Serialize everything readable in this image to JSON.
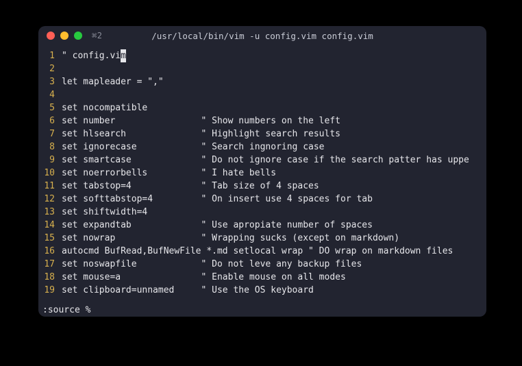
{
  "titlebar": {
    "shortcut": "⌘2",
    "title": "/usr/local/bin/vim -u config.vim config.vim"
  },
  "cursor_line_index": 0,
  "cursor_prefix": "\" config.vi",
  "cursor_char": "m",
  "lines": [
    {
      "n": 1,
      "text": "\" config.vim"
    },
    {
      "n": 2,
      "text": ""
    },
    {
      "n": 3,
      "text": "let mapleader = \",\""
    },
    {
      "n": 4,
      "text": ""
    },
    {
      "n": 5,
      "text": "set nocompatible"
    },
    {
      "n": 6,
      "text": "set number                \" Show numbers on the left"
    },
    {
      "n": 7,
      "text": "set hlsearch              \" Highlight search results"
    },
    {
      "n": 8,
      "text": "set ignorecase            \" Search ingnoring case"
    },
    {
      "n": 9,
      "text": "set smartcase             \" Do not ignore case if the search patter has uppe"
    },
    {
      "n": 10,
      "text": "set noerrorbells          \" I hate bells"
    },
    {
      "n": 11,
      "text": "set tabstop=4             \" Tab size of 4 spaces"
    },
    {
      "n": 12,
      "text": "set softtabstop=4         \" On insert use 4 spaces for tab"
    },
    {
      "n": 13,
      "text": "set shiftwidth=4"
    },
    {
      "n": 14,
      "text": "set expandtab             \" Use apropiate number of spaces"
    },
    {
      "n": 15,
      "text": "set nowrap                \" Wrapping sucks (except on markdown)"
    },
    {
      "n": 16,
      "text": "autocmd BufRead,BufNewFile *.md setlocal wrap \" DO wrap on markdown files"
    },
    {
      "n": 17,
      "text": "set noswapfile            \" Do not leve any backup files"
    },
    {
      "n": 18,
      "text": "set mouse=a               \" Enable mouse on all modes"
    },
    {
      "n": 19,
      "text": "set clipboard=unnamed     \" Use the OS keyboard"
    }
  ],
  "command_line": ":source %"
}
